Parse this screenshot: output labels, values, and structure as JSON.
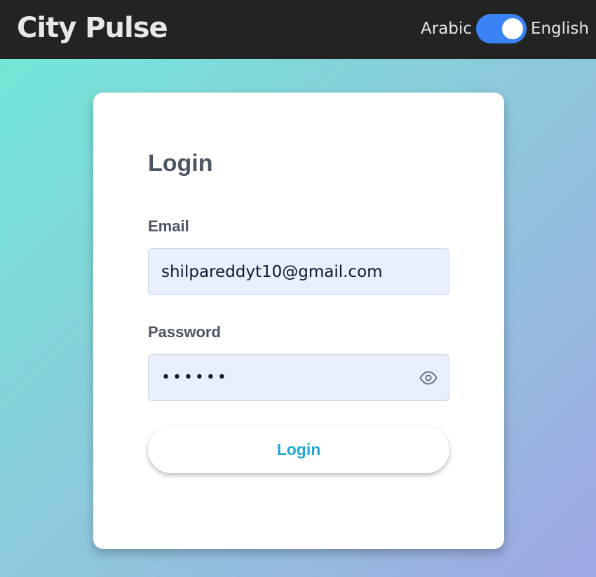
{
  "header": {
    "brand": "City Pulse",
    "language": {
      "left_label": "Arabic",
      "right_label": "English",
      "selected": "English",
      "toggle_color": "#3b82f6"
    }
  },
  "login": {
    "title": "Login",
    "email": {
      "label": "Email",
      "value": "shilpareddyt10@gmail.com"
    },
    "password": {
      "label": "Password",
      "value": "••••••",
      "toggle_icon": "eye-icon"
    },
    "submit_label": "Login",
    "accent_color": "#1ea6d6"
  }
}
